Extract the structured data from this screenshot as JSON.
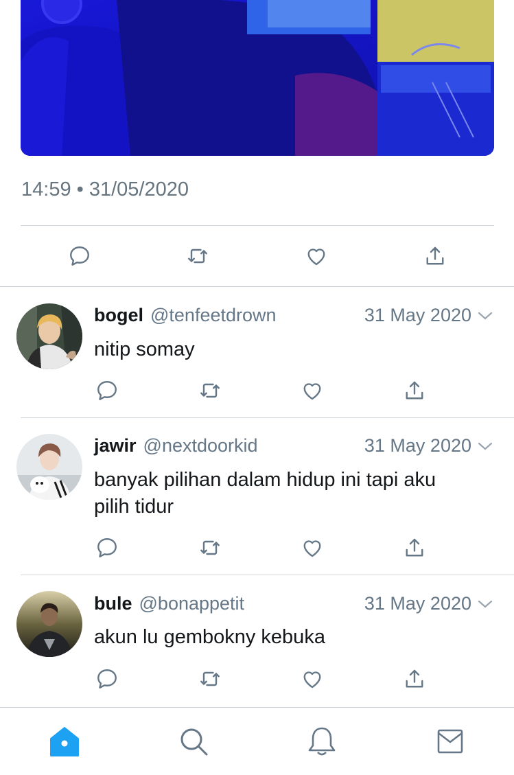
{
  "main_tweet": {
    "timestamp": "14:59 • 31/05/2020",
    "actions": [
      "reply-icon",
      "retweet-icon",
      "like-icon",
      "share-icon"
    ]
  },
  "replies": [
    {
      "name": "bogel",
      "handle": "@tenfeetdrown",
      "date": "31 May 2020",
      "text": "nitip somay"
    },
    {
      "name": "jawir",
      "handle": "@nextdoorkid",
      "date": "31 May 2020",
      "text_line1": "banyak pilihan dalam hidup ini tapi aku",
      "text_line2": "pilih tidur"
    },
    {
      "name": "bule",
      "handle": "@bonappetit",
      "date": "31 May 2020",
      "text": "akun lu gembokny kebuka"
    }
  ],
  "tabbar": {
    "items": [
      "home-icon",
      "search-icon",
      "notifications-icon",
      "messages-icon"
    ],
    "active": "home-icon"
  },
  "colors": {
    "accent": "#1da1f2",
    "icon_gray": "#657786",
    "text_dark": "#14171a"
  }
}
